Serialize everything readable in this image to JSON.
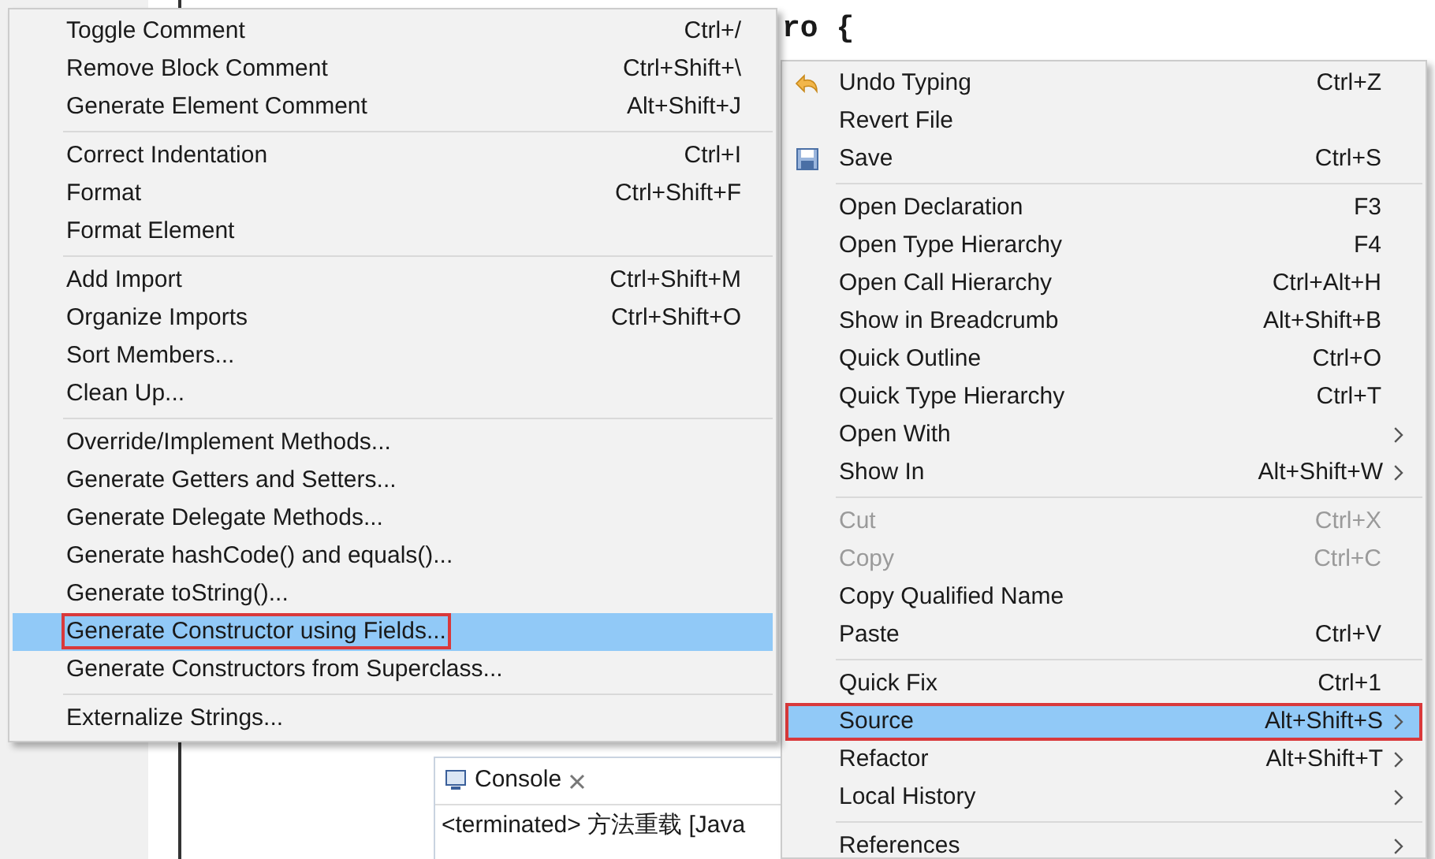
{
  "editor": {
    "code_line": "ro {",
    "console": {
      "tab_title": "Console",
      "status_line": "<terminated> 方法重载 [Java"
    }
  },
  "source_submenu": {
    "groups": [
      [
        {
          "label": "Toggle Comment",
          "shortcut": "Ctrl+/",
          "selected": false,
          "outlined": false
        },
        {
          "label": "Remove Block Comment",
          "shortcut": "Ctrl+Shift+\\",
          "selected": false,
          "outlined": false
        },
        {
          "label": "Generate Element Comment",
          "shortcut": "Alt+Shift+J",
          "selected": false,
          "outlined": false
        }
      ],
      [
        {
          "label": "Correct Indentation",
          "shortcut": "Ctrl+I",
          "selected": false,
          "outlined": false
        },
        {
          "label": "Format",
          "shortcut": "Ctrl+Shift+F",
          "selected": false,
          "outlined": false
        },
        {
          "label": "Format Element",
          "selected": false,
          "outlined": false
        }
      ],
      [
        {
          "label": "Add Import",
          "shortcut": "Ctrl+Shift+M",
          "selected": false,
          "outlined": false
        },
        {
          "label": "Organize Imports",
          "shortcut": "Ctrl+Shift+O",
          "selected": false,
          "outlined": false
        },
        {
          "label": "Sort Members...",
          "selected": false,
          "outlined": false
        },
        {
          "label": "Clean Up...",
          "selected": false,
          "outlined": false
        }
      ],
      [
        {
          "label": "Override/Implement Methods...",
          "selected": false,
          "outlined": false
        },
        {
          "label": "Generate Getters and Setters...",
          "selected": false,
          "outlined": false
        },
        {
          "label": "Generate Delegate Methods...",
          "selected": false,
          "outlined": false
        },
        {
          "label": "Generate hashCode() and equals()...",
          "selected": false,
          "outlined": false
        },
        {
          "label": "Generate toString()...",
          "selected": false,
          "outlined": false
        },
        {
          "label": "Generate Constructor using Fields...",
          "selected": true,
          "outlined": true
        },
        {
          "label": "Generate Constructors from Superclass...",
          "selected": false,
          "outlined": false
        }
      ],
      [
        {
          "label": "Externalize Strings...",
          "selected": false,
          "outlined": false
        }
      ]
    ]
  },
  "context_menu": {
    "groups": [
      [
        {
          "label": "Undo Typing",
          "shortcut": "Ctrl+Z",
          "kind": "undo",
          "disabled": false,
          "submenu": false,
          "selected": false,
          "outlined": false
        },
        {
          "label": "Revert File",
          "disabled": false,
          "submenu": false,
          "selected": false,
          "outlined": false
        },
        {
          "label": "Save",
          "shortcut": "Ctrl+S",
          "kind": "save",
          "disabled": false,
          "submenu": false,
          "selected": false,
          "outlined": false
        }
      ],
      [
        {
          "label": "Open Declaration",
          "shortcut": "F3",
          "disabled": false,
          "submenu": false,
          "selected": false,
          "outlined": false
        },
        {
          "label": "Open Type Hierarchy",
          "shortcut": "F4",
          "disabled": false,
          "submenu": false,
          "selected": false,
          "outlined": false
        },
        {
          "label": "Open Call Hierarchy",
          "shortcut": "Ctrl+Alt+H",
          "disabled": false,
          "submenu": false,
          "selected": false,
          "outlined": false
        },
        {
          "label": "Show in Breadcrumb",
          "shortcut": "Alt+Shift+B",
          "disabled": false,
          "submenu": false,
          "selected": false,
          "outlined": false
        },
        {
          "label": "Quick Outline",
          "shortcut": "Ctrl+O",
          "disabled": false,
          "submenu": false,
          "selected": false,
          "outlined": false
        },
        {
          "label": "Quick Type Hierarchy",
          "shortcut": "Ctrl+T",
          "disabled": false,
          "submenu": false,
          "selected": false,
          "outlined": false
        },
        {
          "label": "Open With",
          "disabled": false,
          "submenu": true,
          "selected": false,
          "outlined": false
        },
        {
          "label": "Show In",
          "shortcut": "Alt+Shift+W",
          "disabled": false,
          "submenu": true,
          "selected": false,
          "outlined": false
        }
      ],
      [
        {
          "label": "Cut",
          "shortcut": "Ctrl+X",
          "disabled": true,
          "submenu": false,
          "selected": false,
          "outlined": false
        },
        {
          "label": "Copy",
          "shortcut": "Ctrl+C",
          "disabled": true,
          "submenu": false,
          "selected": false,
          "outlined": false
        },
        {
          "label": "Copy Qualified Name",
          "disabled": false,
          "submenu": false,
          "selected": false,
          "outlined": false
        },
        {
          "label": "Paste",
          "shortcut": "Ctrl+V",
          "disabled": false,
          "submenu": false,
          "selected": false,
          "outlined": false
        }
      ],
      [
        {
          "label": "Quick Fix",
          "shortcut": "Ctrl+1",
          "disabled": false,
          "submenu": false,
          "selected": false,
          "outlined": false
        },
        {
          "label": "Source",
          "shortcut": "Alt+Shift+S",
          "disabled": false,
          "submenu": true,
          "selected": true,
          "outlined": true
        },
        {
          "label": "Refactor",
          "shortcut": "Alt+Shift+T",
          "disabled": false,
          "submenu": true,
          "selected": false,
          "outlined": false
        },
        {
          "label": "Local History",
          "disabled": false,
          "submenu": true,
          "selected": false,
          "outlined": false
        }
      ],
      [
        {
          "label": "References",
          "disabled": false,
          "submenu": true,
          "selected": false,
          "outlined": false
        }
      ]
    ]
  }
}
